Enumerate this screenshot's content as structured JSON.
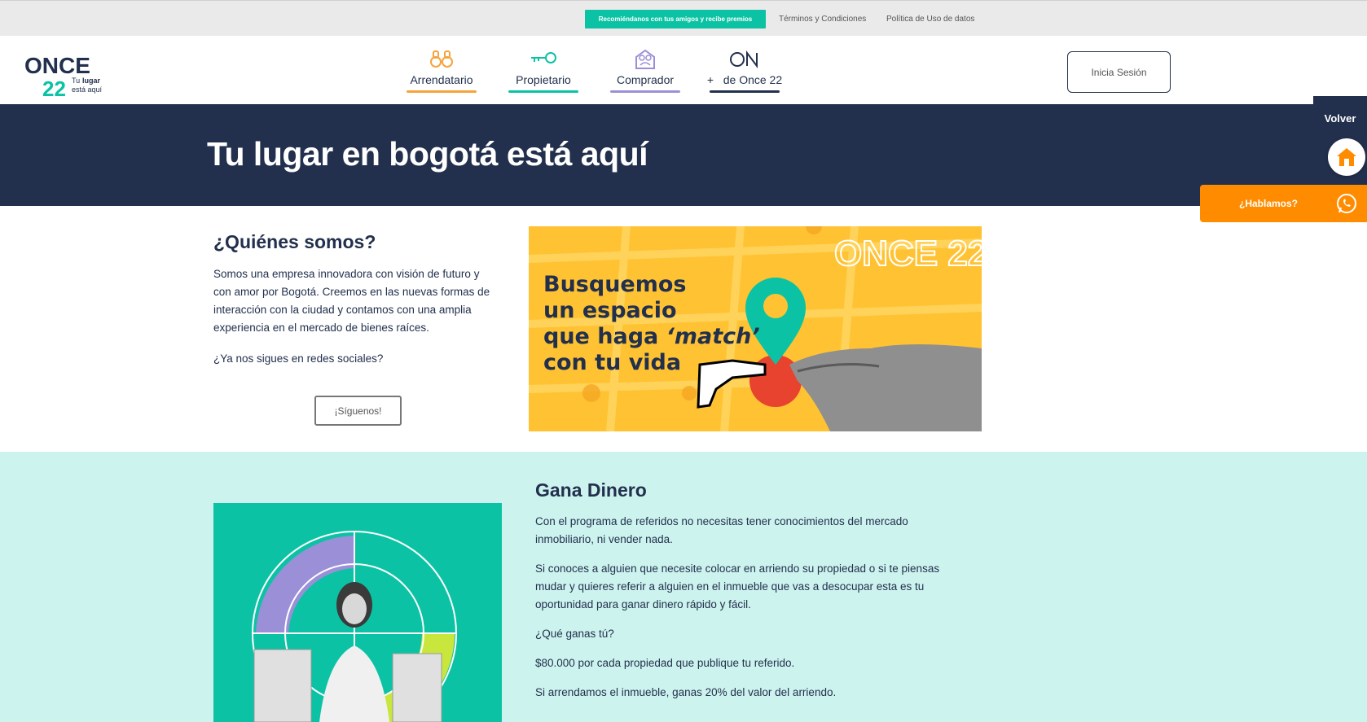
{
  "topbar": {
    "promo": "Recomiéndanos con tus amigos y recibe premios",
    "terms": "Términos y Condiciones",
    "privacy": "Política de Uso de datos"
  },
  "header": {
    "logo_text": "ONCE",
    "logo_number": "22",
    "logo_tagline_1": "Tu",
    "logo_tagline_bold": "lugar",
    "logo_tagline_2": "está aquí",
    "nav": [
      {
        "label": "Arrendatario",
        "icon": "binoculars-icon",
        "color": "#f6a33b"
      },
      {
        "label": "Propietario",
        "icon": "key-icon",
        "color": "#0bc3a4"
      },
      {
        "label": "Comprador",
        "icon": "family-icon",
        "color": "#9b8fd8"
      },
      {
        "label": "de Once 22",
        "prefix": "+",
        "icon": "on-logo-icon",
        "color": "#22304d"
      }
    ],
    "login": "Inicia Sesión"
  },
  "hero": {
    "title": "Tu lugar en bogotá está aquí"
  },
  "about": {
    "title": "¿Quiénes somos?",
    "body": "Somos una empresa innovadora con visión de futuro y con amor por Bogotá. Creemos en las nuevas formas de interacción con la ciudad y contamos con una amplia experiencia en el mercado de bienes raíces.",
    "question": "¿Ya nos sigues en redes sociales?",
    "follow_button": "¡Síguenos!",
    "promo_line1": "Busquemos",
    "promo_line2": "un espacio",
    "promo_line3a": "que haga",
    "promo_line3b": "‘match’",
    "promo_line4": "con tu vida",
    "promo_logo": "ONCE 22"
  },
  "earn": {
    "title": "Gana Dinero",
    "p1": "Con el programa de referidos no necesitas tener conocimientos del mercado inmobiliario, ni vender nada.",
    "p2": "Si conoces a alguien que necesite colocar en arriendo su propiedad o si te piensas mudar y quieres referir a alguien en el inmueble que vas a desocupar esta es tu oportunidad para ganar dinero rápido y fácil.",
    "p3": "¿Qué ganas tú?",
    "p4": "$80.000 por cada propiedad que publique tu referido.",
    "p5": "Si arrendamos el inmueble, ganas 20% del valor del arriendo."
  },
  "floating": {
    "back": "Volver",
    "chat": "¿Hablamos?"
  },
  "colors": {
    "navy": "#22304d",
    "teal": "#0bc3a4",
    "yellow": "#ffc233",
    "orange": "#ff8c00",
    "mint": "#cdf3ee"
  }
}
